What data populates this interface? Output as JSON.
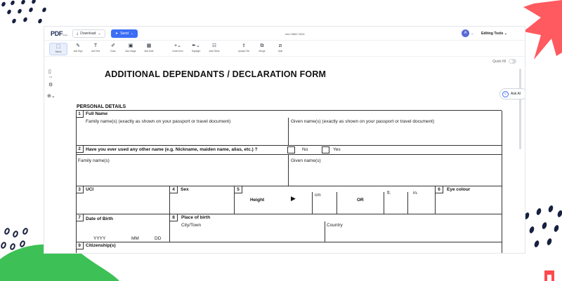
{
  "colors": {
    "accent": "#3b6ef5",
    "decor_red": "#ff5a5f",
    "decor_green": "#3dc156",
    "decor_navy": "#17203f"
  },
  "topbar": {
    "logo": "PDF",
    "logo_sub": "Simpli",
    "download_label": "Download",
    "send_label": "Send",
    "doc_name": "imm 5562 2004",
    "avatar_initial": "A",
    "editing_tools_label": "Editing Tools"
  },
  "toolbar": {
    "tools": [
      {
        "label": "Select",
        "icon": "select-icon"
      },
      {
        "label": "Add Sign",
        "icon": "pen-icon"
      },
      {
        "label": "Add Text",
        "icon": "text-icon"
      },
      {
        "label": "Draw",
        "icon": "draw-icon"
      },
      {
        "label": "Add Image",
        "icon": "image-icon"
      },
      {
        "label": "Add Date",
        "icon": "calendar-icon"
      },
      {
        "label": "Insert Item",
        "icon": "insert-icon"
      },
      {
        "label": "Highlight",
        "icon": "highlight-icon"
      },
      {
        "label": "Add Fields",
        "icon": "fields-icon"
      },
      {
        "label": "Upload File",
        "icon": "upload-icon"
      },
      {
        "label": "Merge",
        "icon": "merge-icon"
      },
      {
        "label": "Split",
        "icon": "split-icon"
      }
    ]
  },
  "quick_fill_label": "Quick fill",
  "side": {
    "page_label": "1/4"
  },
  "ask_ai_label": "Ask AI",
  "form": {
    "title": "ADDITIONAL DEPENDANTS / DECLARATION FORM",
    "section": "PERSONAL DETAILS",
    "q1": {
      "num": "1",
      "label": "Full Name",
      "family": "Family name(s)  (exactly as shown on your passport or travel document)",
      "given": "Given name(s)  (exactly as shown on your passport or travel document)"
    },
    "q2": {
      "num": "2",
      "label": "Have you ever used any other name (e.g. Nickname, maiden name, alias, etc.) ?",
      "no": "No",
      "yes": "Yes",
      "family": "Family name(s)",
      "given": "Given name(s)"
    },
    "q3": {
      "num": "3",
      "label": "UCI"
    },
    "q4": {
      "num": "4",
      "label": "Sex"
    },
    "q5": {
      "num": "5",
      "height": "Height",
      "cm": "cm",
      "or": "OR",
      "ft": "ft.",
      "in": "in."
    },
    "q6": {
      "num": "6",
      "label": "Eye colour"
    },
    "q7": {
      "num": "7",
      "label": "Date of Birth",
      "yyyy": "YYYY",
      "mm": "MM",
      "dd": "DD"
    },
    "q8": {
      "num": "8",
      "label": "Place of birth",
      "city": "City/Town",
      "country": "Country"
    },
    "q9": {
      "num": "9",
      "label": "Citizenship(s)"
    }
  }
}
